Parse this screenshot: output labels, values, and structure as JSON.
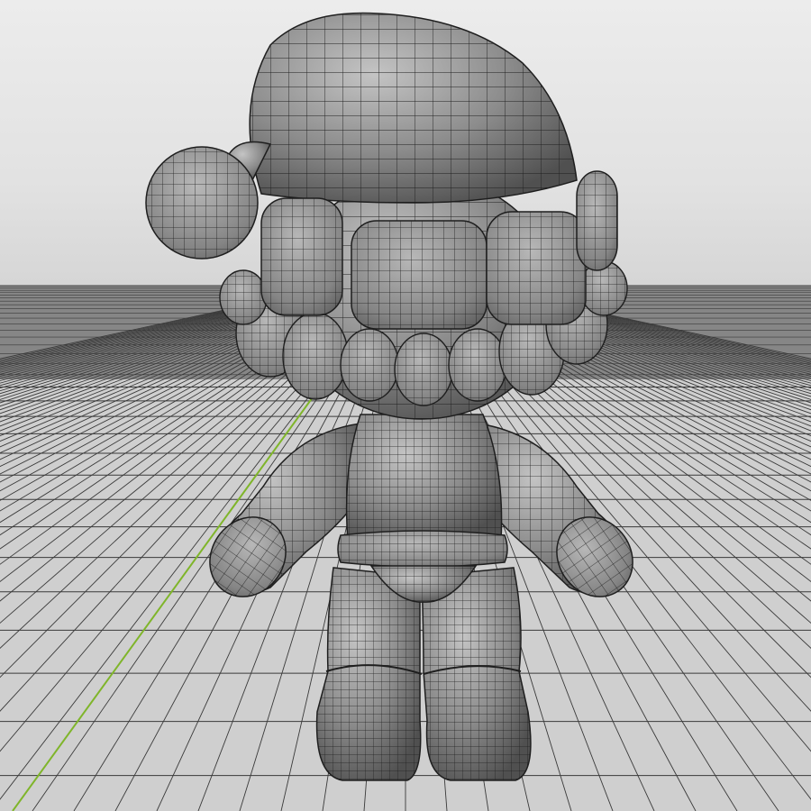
{
  "viewport": {
    "mode": "3d-viewport",
    "shading": "solid",
    "overlay": "wireframe",
    "view": "front-perspective"
  },
  "scene": {
    "object": "character-mesh",
    "parts": [
      "santa-hat",
      "pompom",
      "hat-brim",
      "head",
      "torso",
      "arms",
      "belt",
      "legs",
      "feet"
    ],
    "grid_floor": true,
    "y_axis_visible": true
  },
  "colors": {
    "sky_top": "#ececec",
    "sky_bottom": "#d6d6d6",
    "floor": "#cfcfcf",
    "grid_line": "#3a3a3a",
    "horizon_band": "#4a4a4a",
    "y_axis": "#7fb52a",
    "mesh_fill": "#8a8a8a",
    "mesh_light": "#bdbdbd",
    "mesh_dark": "#4f4f4f",
    "wire": "#1e1e1e"
  }
}
